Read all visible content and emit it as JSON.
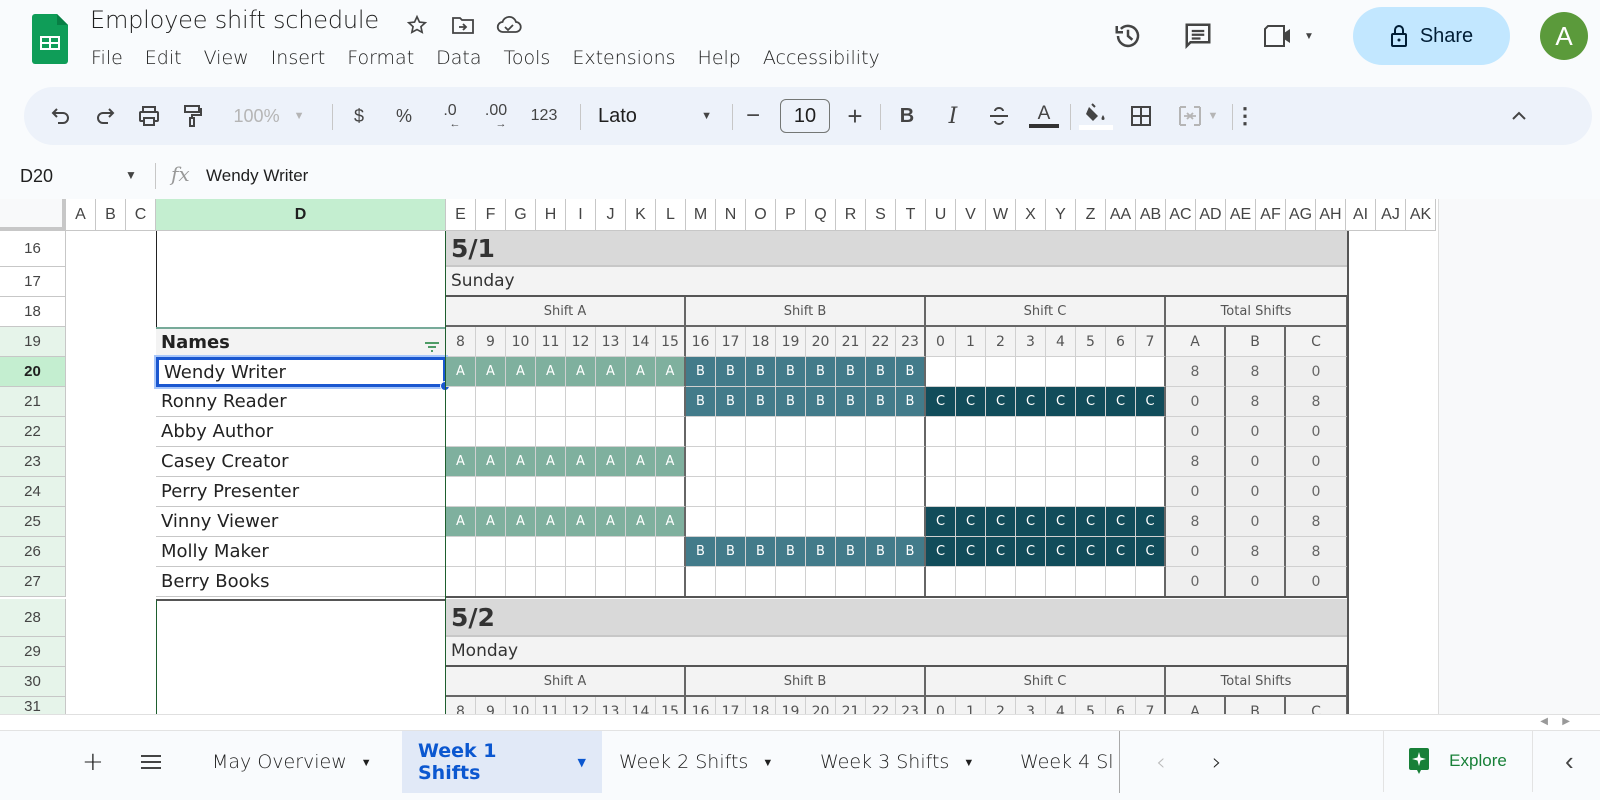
{
  "app": {
    "title": "Employee shift schedule",
    "menu": [
      "File",
      "Edit",
      "View",
      "Insert",
      "Format",
      "Data",
      "Tools",
      "Extensions",
      "Help",
      "Accessibility"
    ],
    "share_label": "Share",
    "avatar_initial": "A",
    "brand_color": "#0f9d58"
  },
  "toolbar": {
    "zoom": "100%",
    "currency": "$",
    "percent": "%",
    "decrease_decimal": ".0",
    "increase_decimal": ".00",
    "number_format": "123",
    "font": "Lato",
    "font_size": "10",
    "bold": "B",
    "italic": "I",
    "text_color_letter": "A"
  },
  "formula_bar": {
    "name_box": "D20",
    "fx": "fx",
    "value": "Wendy Writer"
  },
  "columns": [
    "A",
    "B",
    "C",
    "D",
    "E",
    "F",
    "G",
    "H",
    "I",
    "J",
    "K",
    "L",
    "M",
    "N",
    "O",
    "P",
    "Q",
    "R",
    "S",
    "T",
    "U",
    "V",
    "W",
    "X",
    "Y",
    "Z",
    "AA",
    "AB",
    "AC",
    "AD",
    "AE",
    "AF",
    "AG",
    "AH",
    "AI",
    "AJ",
    "AK"
  ],
  "selected_column": "D",
  "rows": [
    "16",
    "17",
    "18",
    "19",
    "20",
    "21",
    "22",
    "23",
    "24",
    "25",
    "26",
    "27",
    "28",
    "29",
    "30",
    "31"
  ],
  "selected_row": "20",
  "schedule": {
    "names_header": "Names",
    "shift_labels": [
      "Shift A",
      "Shift B",
      "Shift C",
      "Total Shifts"
    ],
    "hours": [
      "8",
      "9",
      "10",
      "11",
      "12",
      "13",
      "14",
      "15",
      "16",
      "17",
      "18",
      "19",
      "20",
      "21",
      "22",
      "23",
      "0",
      "1",
      "2",
      "3",
      "4",
      "5",
      "6",
      "7"
    ],
    "total_headers": [
      "A",
      "B",
      "C"
    ],
    "shift_colors": {
      "A": "#7fb09e",
      "B": "#427b8a",
      "C": "#114c5a"
    },
    "days": [
      {
        "date": "5/1",
        "weekday": "Sunday",
        "employees": [
          {
            "name": "Wendy Writer",
            "shifts": [
              "A",
              "B"
            ],
            "totals": [
              "8",
              "8",
              "0"
            ]
          },
          {
            "name": "Ronny Reader",
            "shifts": [
              "B",
              "C"
            ],
            "totals": [
              "0",
              "8",
              "8"
            ]
          },
          {
            "name": "Abby Author",
            "shifts": [],
            "totals": [
              "0",
              "0",
              "0"
            ]
          },
          {
            "name": "Casey Creator",
            "shifts": [
              "A"
            ],
            "totals": [
              "8",
              "0",
              "0"
            ]
          },
          {
            "name": "Perry Presenter",
            "shifts": [],
            "totals": [
              "0",
              "0",
              "0"
            ]
          },
          {
            "name": "Vinny Viewer",
            "shifts": [
              "A",
              "C"
            ],
            "totals": [
              "8",
              "0",
              "8"
            ]
          },
          {
            "name": "Molly Maker",
            "shifts": [
              "B",
              "C"
            ],
            "totals": [
              "0",
              "8",
              "8"
            ]
          },
          {
            "name": "Berry Books",
            "shifts": [],
            "totals": [
              "0",
              "0",
              "0"
            ]
          }
        ]
      },
      {
        "date": "5/2",
        "weekday": "Monday"
      }
    ]
  },
  "sheets": {
    "tabs": [
      "May Overview",
      "Week 1 Shifts",
      "Week 2 Shifts",
      "Week 3 Shifts",
      "Week 4 Sl"
    ],
    "active": "Week 1 Shifts",
    "explore_label": "Explore"
  }
}
